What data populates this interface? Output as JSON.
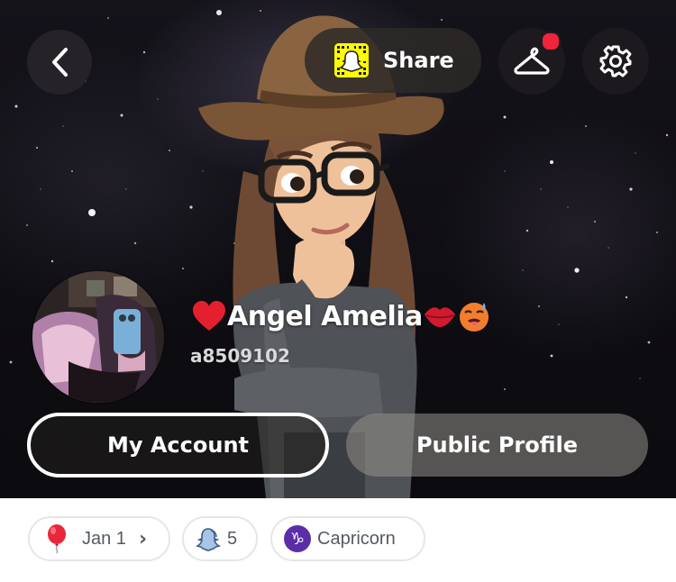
{
  "header": {
    "back_icon": "chevron-left-icon",
    "share_label": "Share",
    "snapcode_icon": "snapcode-icon",
    "outfit_icon": "hanger-icon",
    "settings_icon": "gear-icon",
    "notification_dot_color": "#f0243a"
  },
  "profile": {
    "display_name": "Angel Amelia",
    "name_prefix_emoji_icon": "red-heart-icon",
    "name_suffix_emoji_icons": [
      "kiss-lips-icon",
      "hot-face-icon"
    ],
    "username": "a8509102"
  },
  "actions": {
    "my_account_label": "My Account",
    "public_profile_label": "Public Profile"
  },
  "chips": {
    "birthday": {
      "icon": "balloon-icon",
      "label": "Jan 1",
      "chevron": "›"
    },
    "friends": {
      "icon": "ghost-icon",
      "count": "5"
    },
    "zodiac": {
      "icon": "capricorn-icon",
      "symbol": "♑",
      "label": "Capricorn"
    }
  },
  "colors": {
    "snap_yellow": "#fffc00",
    "zodiac_purple": "#5b2ea8",
    "chip_border": "#e6e6e6",
    "chip_text": "#555a62"
  }
}
